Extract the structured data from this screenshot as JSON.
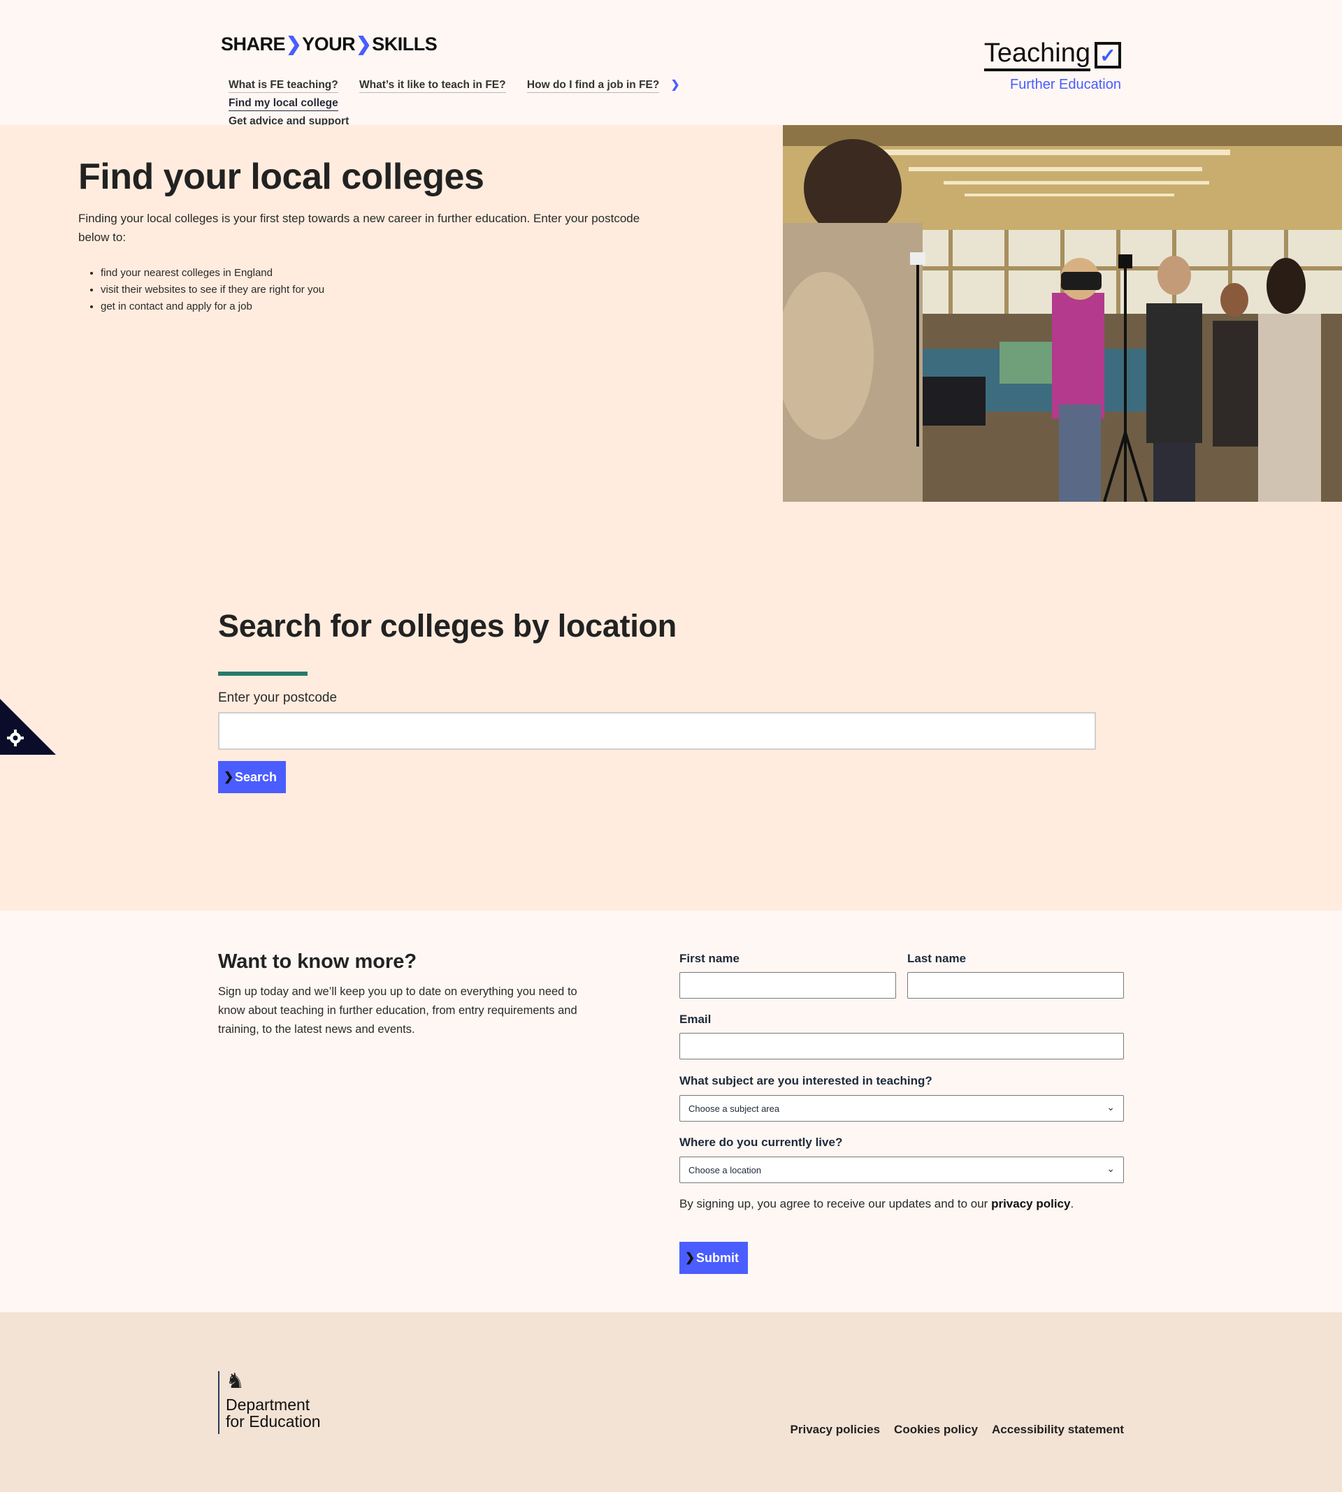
{
  "header": {
    "brand_share": "SHARE",
    "brand_your": "YOUR",
    "brand_skills": "SKILLS",
    "nav": [
      {
        "label": "What is FE teaching?"
      },
      {
        "label": "What’s it like to teach in FE?"
      },
      {
        "label": "How do I find a job in FE?"
      },
      {
        "label": "Find my local college"
      },
      {
        "label": "Get advice and support"
      }
    ],
    "logo_title": "Teaching",
    "logo_subtitle": "Further Education"
  },
  "hero": {
    "title": "Find your local colleges",
    "intro": "Finding your local colleges is your first step towards a new career in further education. Enter your postcode below to:",
    "bullets": [
      "find your nearest colleges in England",
      "visit their websites to see if they are right for you",
      "get in contact and apply for a job"
    ]
  },
  "search": {
    "title": "Search for colleges by location",
    "postcode_label": "Enter your postcode",
    "postcode_value": "",
    "button_label": "Search"
  },
  "signup": {
    "title": "Want to know more?",
    "description": "Sign up today and we’ll keep you up to date on everything you need to know about teaching in further education, from entry requirements and training, to the latest news and events.",
    "first_name_label": "First name",
    "last_name_label": "Last name",
    "email_label": "Email",
    "subject_label": "What subject are you interested in teaching?",
    "subject_selected": "Choose a subject area",
    "location_label": "Where do you currently live?",
    "location_selected": "Choose a location",
    "consent_text": "By signing up, you agree to receive our updates and to our ",
    "consent_link": "privacy policy",
    "consent_end": ".",
    "submit_label": "Submit"
  },
  "footer": {
    "org_line1": "Department",
    "org_line2": "for Education",
    "links": [
      "Privacy policies",
      "Cookies policy",
      "Accessibility statement"
    ]
  },
  "colors": {
    "accent": "#4a5dff",
    "rule": "#287a6c",
    "hero_bg": "#ffecde",
    "footer_bg": "#f3e3d5"
  }
}
